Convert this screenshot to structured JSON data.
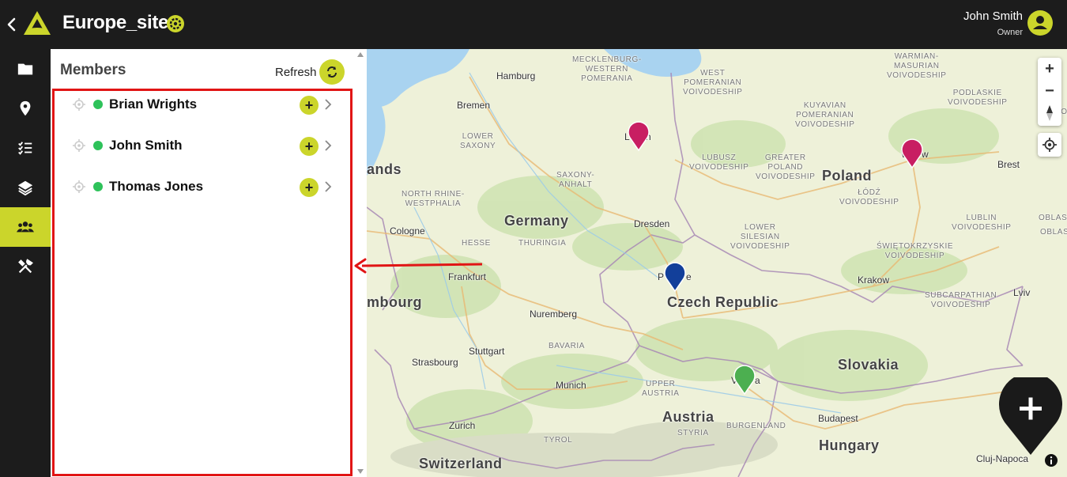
{
  "header": {
    "project_title": "Europe_sites",
    "user_name": "John Smith",
    "user_role": "Owner"
  },
  "rail": {
    "items": [
      {
        "icon": "folder-icon",
        "active": false
      },
      {
        "icon": "map-pin-icon",
        "active": false
      },
      {
        "icon": "checklist-icon",
        "active": false
      },
      {
        "icon": "layers-icon",
        "active": false
      },
      {
        "icon": "users-icon",
        "active": true
      },
      {
        "icon": "tools-icon",
        "active": false
      }
    ]
  },
  "panel": {
    "title": "Members",
    "refresh_label": "Refresh",
    "members": [
      {
        "name": "Brian Wrights",
        "status": "online"
      },
      {
        "name": "John Smith",
        "status": "online"
      },
      {
        "name": "Thomas Jones",
        "status": "online"
      }
    ]
  },
  "map": {
    "countries": [
      "Germany",
      "Poland",
      "Czech Republic",
      "Austria",
      "Slovakia",
      "Hungary",
      "Switzerland",
      "ands",
      "mbourg"
    ],
    "cities": [
      "Hamburg",
      "Bremen",
      "Dresden",
      "Cologne",
      "Frankfurt",
      "Nuremberg",
      "Stuttgart",
      "Strasbourg",
      "Munich",
      "Zurich",
      "Krakow",
      "Brest",
      "Lviv",
      "Budapest",
      "Cluj-Napoca",
      "L",
      "n",
      "W",
      "w",
      "P",
      "e",
      "V",
      "a"
    ],
    "regions": [
      "MECKLENBURG-\nWESTERN\nPOMERANIA",
      "WEST\nPOMERANIAN\nVOIVODESHIP",
      "WARMIAN-\nMASURIAN\nVOIVODESHIP",
      "PODLASKIE\nVOIVODESHIP",
      "KUYAVIAN\nPOMERANIAN\nVOIVODESHIP",
      "LOWER\nSAXONY",
      "LUBUSZ\nVOIVODESHIP",
      "GREATER\nPOLAND\nVOIVODESHIP",
      "SAXONY-\nANHALT",
      "NORTH RHINE-\nWESTPHALIA",
      "ŁÓDŹ\nVOIVODESHIP",
      "LUBLIN\nVOIVODESHIP",
      "HESSE",
      "THURINGIA",
      "LOWER\nSILESIAN\nVOIVODESHIP",
      "ŚWIĘTOKRZYSKIE\nVOIVODESHIP",
      "SUBCARPATHIAN\nVOIVODESHIP",
      "BAVARIA",
      "UPPER\nAUSTRIA",
      "STYRIA",
      "TYROL",
      "BURGENLAND",
      "OBLAST",
      "OBLAS",
      "VOIVODESHIP"
    ],
    "pins": [
      {
        "color": "#c81e62"
      },
      {
        "color": "#c81e62"
      },
      {
        "color": "#123f9a"
      },
      {
        "color": "#4caf50"
      }
    ],
    "zoom_in_label": "+",
    "zoom_out_label": "−"
  },
  "colors": {
    "accent": "#cbd52b",
    "status_online": "#2ec25a",
    "highlight": "#e11515"
  }
}
